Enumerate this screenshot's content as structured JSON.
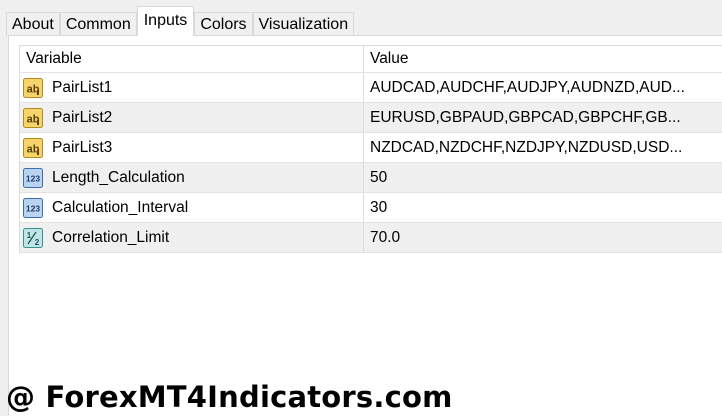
{
  "tabs": [
    {
      "label": "About",
      "active": false
    },
    {
      "label": "Common",
      "active": false
    },
    {
      "label": "Inputs",
      "active": true
    },
    {
      "label": "Colors",
      "active": false
    },
    {
      "label": "Visualization",
      "active": false
    }
  ],
  "table": {
    "headers": {
      "variable": "Variable",
      "value": "Value"
    },
    "rows": [
      {
        "icon": "string-ab-icon",
        "variable": "PairList1",
        "value": "AUDCAD,AUDCHF,AUDJPY,AUDNZD,AUD..."
      },
      {
        "icon": "string-ab-icon",
        "variable": "PairList2",
        "value": "EURUSD,GBPAUD,GBPCAD,GBPCHF,GB..."
      },
      {
        "icon": "string-ab-icon",
        "variable": "PairList3",
        "value": "NZDCAD,NZDCHF,NZDJPY,NZDUSD,USD..."
      },
      {
        "icon": "integer-123-icon",
        "variable": "Length_Calculation",
        "value": "50"
      },
      {
        "icon": "integer-123-icon",
        "variable": "Calculation_Interval",
        "value": "30"
      },
      {
        "icon": "double-half-icon",
        "variable": "Correlation_Limit",
        "value": "70.0"
      }
    ]
  },
  "watermark": "@ ForexMT4Indicators.com"
}
